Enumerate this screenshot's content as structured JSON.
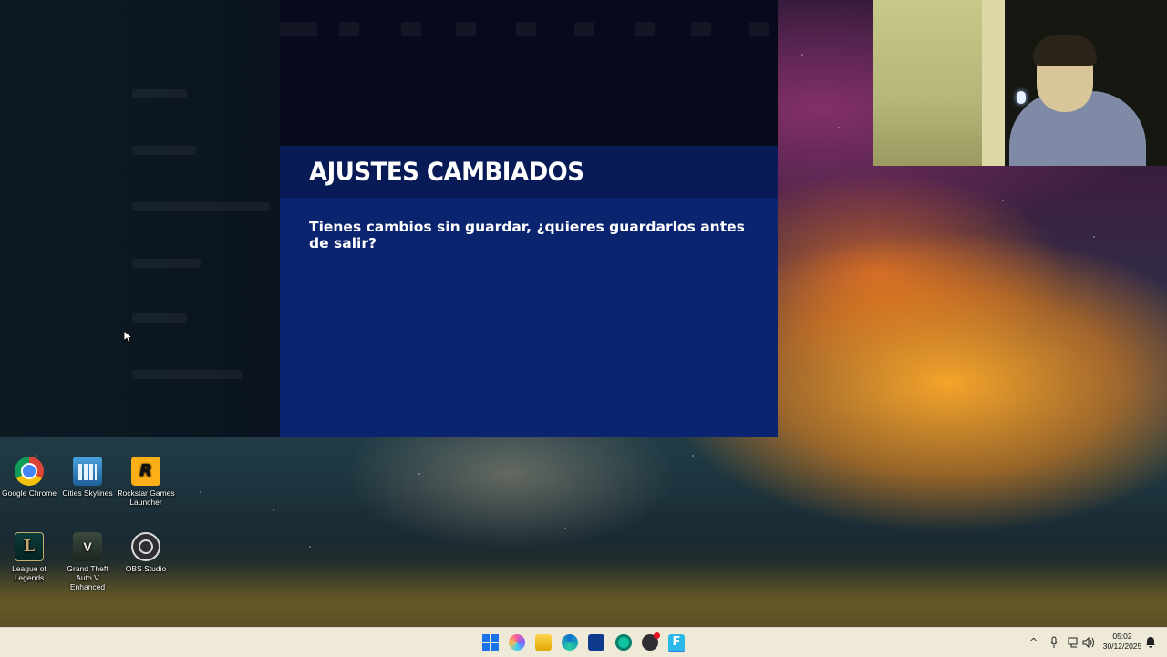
{
  "game": {
    "dialog": {
      "title": "AJUSTES CAMBIADOS",
      "message": "Tienes cambios sin guardar, ¿quieres guardarlos antes de salir?"
    }
  },
  "desktop": {
    "icons": [
      {
        "label": "Google Chrome",
        "icon": "chrome-icon"
      },
      {
        "label": "Cities Skylines",
        "icon": "cities-skylines-icon"
      },
      {
        "label": "Rockstar Games Launcher",
        "icon": "rockstar-icon",
        "glyph": "R"
      },
      {
        "label": "League of Legends",
        "icon": "league-of-legends-icon",
        "glyph": "L"
      },
      {
        "label": "Grand Theft Auto V Enhanced",
        "icon": "gta-v-icon",
        "glyph": "V"
      },
      {
        "label": "OBS Studio",
        "icon": "obs-icon"
      }
    ]
  },
  "taskbar": {
    "apps": [
      "start-icon",
      "copilot-icon",
      "file-explorer-icon",
      "edge-icon",
      "store-icon",
      "app-icon",
      "obs-icon",
      "fortnite-icon"
    ],
    "fortnite_glyph": "F",
    "tray": {
      "chevron": "^",
      "time": "05:02",
      "date": "30/12/2025"
    }
  },
  "colors": {
    "dialog_bg": "#0b2470",
    "dialog_header": "#081b56",
    "taskbar_bg": "#efe9d8"
  }
}
